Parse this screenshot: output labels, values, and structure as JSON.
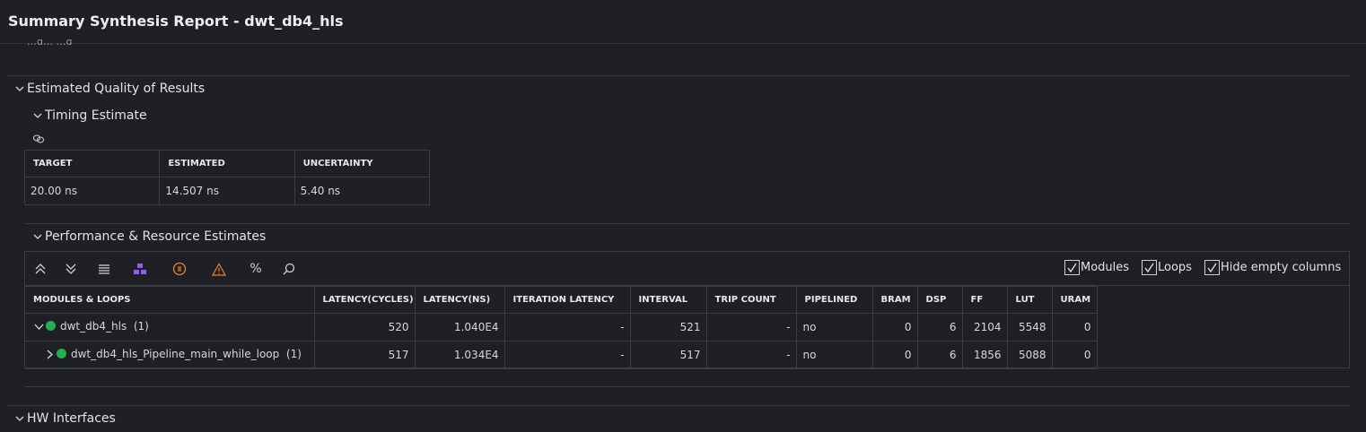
{
  "window": {
    "title": "Summary Synthesis Report - dwt_db4_hls",
    "clipped_text": "…g…  …g"
  },
  "sections": {
    "qor": "Estimated Quality of Results",
    "timing": "Timing Estimate",
    "perf": "Performance & Resource Estimates",
    "hw": "HW Interfaces"
  },
  "timing_table": {
    "headers": [
      "TARGET",
      "ESTIMATED",
      "UNCERTAINTY"
    ],
    "values": [
      "20.00 ns",
      "14.507 ns",
      "5.40 ns"
    ]
  },
  "toolbar": {
    "icons": [
      "collapse-all-icon",
      "expand-all-icon",
      "list-icon",
      "hierarchy-icon",
      "info-icon",
      "warning-icon",
      "percent-icon",
      "search-icon"
    ],
    "percent_label": "%",
    "checkboxes": [
      {
        "label": "Modules",
        "checked": true
      },
      {
        "label": "Loops",
        "checked": true
      },
      {
        "label": "Hide empty columns",
        "checked": true
      }
    ]
  },
  "perf_table": {
    "headers": [
      "MODULES & LOOPS",
      "LATENCY(CYCLES)",
      "LATENCY(NS)",
      "ITERATION LATENCY",
      "INTERVAL",
      "TRIP COUNT",
      "PIPELINED",
      "BRAM",
      "DSP",
      "FF",
      "LUT",
      "URAM"
    ],
    "rows": [
      {
        "name": "dwt_db4_hls",
        "count": "(1)",
        "expanded": true,
        "cells": [
          "520",
          "1.040E4",
          "-",
          "521",
          "-",
          "no",
          "0",
          "6",
          "2104",
          "5548",
          "0"
        ]
      },
      {
        "name": "dwt_db4_hls_Pipeline_main_while_loop",
        "count": "(1)",
        "expanded": false,
        "cells": [
          "517",
          "1.034E4",
          "-",
          "517",
          "-",
          "no",
          "0",
          "6",
          "1856",
          "5088",
          "0"
        ]
      }
    ]
  },
  "colors": {
    "background": "#1f1f26",
    "status_ok": "#22b14c",
    "accent_purple": "#8b5cf6",
    "accent_orange": "#e8822a"
  }
}
